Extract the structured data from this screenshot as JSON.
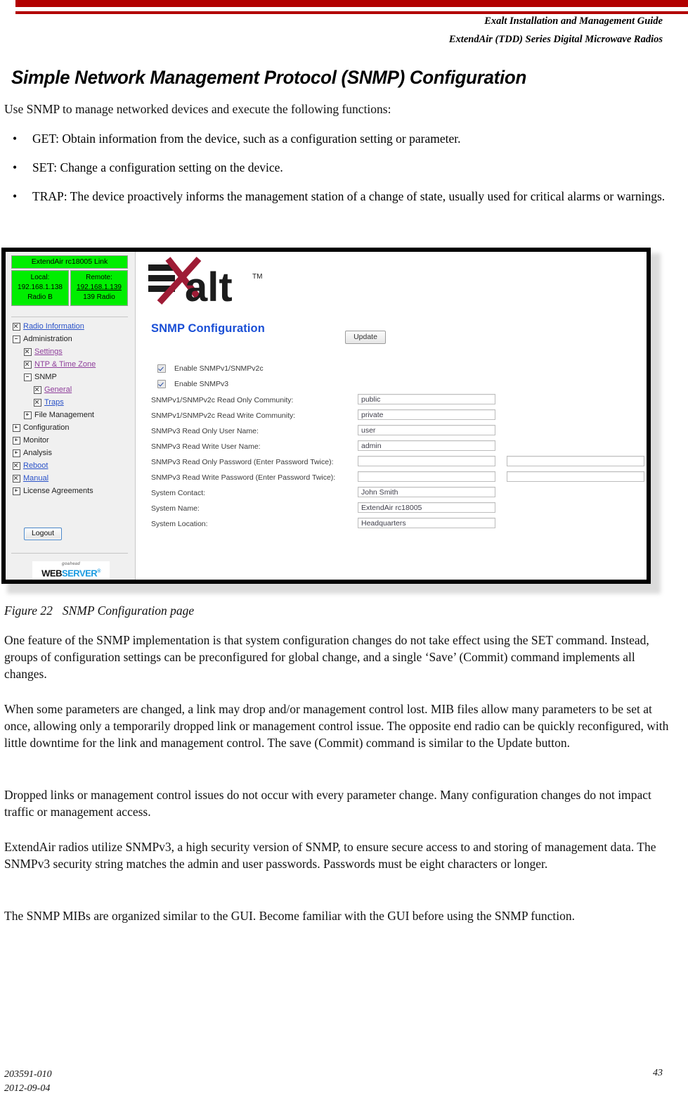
{
  "header": {
    "line1": "Exalt Installation and Management Guide",
    "line2": "ExtendAir (TDD) Series Digital Microwave Radios",
    "rule_color": "#b20000"
  },
  "heading": "Simple Network Management Protocol (SNMP) Configuration",
  "intro": "Use SNMP to manage networked devices and execute the following functions:",
  "bullets": [
    "GET: Obtain information from the device, such as a configuration setting or parameter.",
    "SET: Change a configuration setting on the device.",
    "TRAP: The device proactively informs the management station of a change of state, usually used for critical alarms or warnings."
  ],
  "figure": {
    "caption_number": "Figure 22",
    "caption_text": "SNMP Configuration page",
    "screenshot": {
      "link_status": {
        "title": "ExtendAir rc18005 Link",
        "local": {
          "line1": "Local:",
          "line2": "192.168.1.138",
          "line3": "Radio B"
        },
        "remote": {
          "line1": "Remote:",
          "line2": "192.168.1.139",
          "line3": "139 Radio"
        },
        "status_color": "#00ee00"
      },
      "nav": [
        {
          "label": "Radio Information",
          "icon": "box-x-icon",
          "indent": 0,
          "link": true,
          "visited": false
        },
        {
          "label": "Administration",
          "icon": "box-minus-icon",
          "indent": 0,
          "link": false,
          "visited": false
        },
        {
          "label": "Settings",
          "icon": "box-x-icon",
          "indent": 1,
          "link": true,
          "visited": true
        },
        {
          "label": "NTP & Time Zone",
          "icon": "box-x-icon",
          "indent": 1,
          "link": true,
          "visited": true
        },
        {
          "label": "SNMP",
          "icon": "box-minus-icon",
          "indent": 1,
          "link": false,
          "visited": false
        },
        {
          "label": "General",
          "icon": "box-x-icon",
          "indent": 2,
          "link": true,
          "visited": true
        },
        {
          "label": "Traps",
          "icon": "box-x-icon",
          "indent": 2,
          "link": true,
          "visited": false
        },
        {
          "label": "File Management",
          "icon": "box-plus-icon",
          "indent": 1,
          "link": false,
          "visited": false
        },
        {
          "label": "Configuration",
          "icon": "box-plus-icon",
          "indent": 0,
          "link": false,
          "visited": false
        },
        {
          "label": "Monitor",
          "icon": "box-plus-icon",
          "indent": 0,
          "link": false,
          "visited": false
        },
        {
          "label": "Analysis",
          "icon": "box-plus-icon",
          "indent": 0,
          "link": false,
          "visited": false
        },
        {
          "label": "Reboot",
          "icon": "box-x-icon",
          "indent": 0,
          "link": true,
          "visited": false
        },
        {
          "label": "Manual",
          "icon": "box-x-icon",
          "indent": 0,
          "link": true,
          "visited": false
        },
        {
          "label": "License Agreements",
          "icon": "box-plus-icon",
          "indent": 0,
          "link": false,
          "visited": false
        }
      ],
      "logout_label": "Logout",
      "webserver_logo": {
        "top": "goahead",
        "word1": "WEB",
        "word2": "SERVER",
        "tm": "®"
      },
      "brand": "Exalt",
      "page_title": "SNMP Configuration",
      "update_label": "Update",
      "checkboxes": [
        {
          "label": "Enable SNMPv1/SNMPv2c",
          "checked": true
        },
        {
          "label": "Enable SNMPv3",
          "checked": true
        }
      ],
      "fields": [
        {
          "label": "SNMPv1/SNMPv2c Read Only Community:",
          "value": "public",
          "second": null
        },
        {
          "label": "SNMPv1/SNMPv2c Read Write Community:",
          "value": "private",
          "second": null
        },
        {
          "label": "SNMPv3 Read Only User Name:",
          "value": "user",
          "second": null
        },
        {
          "label": "SNMPv3 Read Write User Name:",
          "value": "admin",
          "second": null
        },
        {
          "label": "SNMPv3 Read Only Password (Enter Password Twice):",
          "value": "",
          "second": ""
        },
        {
          "label": "SNMPv3 Read Write Password (Enter Password Twice):",
          "value": "",
          "second": ""
        },
        {
          "label": "System Contact:",
          "value": "John Smith",
          "second": null
        },
        {
          "label": "System Name:",
          "value": "ExtendAir rc18005",
          "second": null
        },
        {
          "label": "System Location:",
          "value": "Headquarters",
          "second": null
        }
      ]
    }
  },
  "paragraphs": {
    "p1": "One feature of the SNMP implementation is that system configuration changes do not take effect using the SET command. Instead, groups of configuration settings can be preconfigured for global change, and a single ‘Save’ (Commit) command implements all changes.",
    "p2": "When some parameters are changed, a link may drop and/or management control lost. MIB files allow many parameters to be set at once, allowing only a temporarily dropped link or management control issue. The opposite end radio can be quickly reconfigured, with little downtime for the link and management control. The save (Commit) command is similar to the Update button.",
    "p3": "Dropped links or management control issues do not occur with every parameter change. Many configuration changes do not impact traffic or management access.",
    "p4": "ExtendAir radios utilize SNMPv3, a high security version of SNMP, to ensure secure access to and storing of management data. The SNMPv3 security string matches the admin and user passwords. Passwords must be eight characters or longer.",
    "p5": "The SNMP MIBs are organized similar to the GUI. Become familiar with the GUI before using the SNMP function."
  },
  "footer": {
    "doc_number": "203591-010",
    "date": "2012-09-04",
    "page_number": "43"
  }
}
